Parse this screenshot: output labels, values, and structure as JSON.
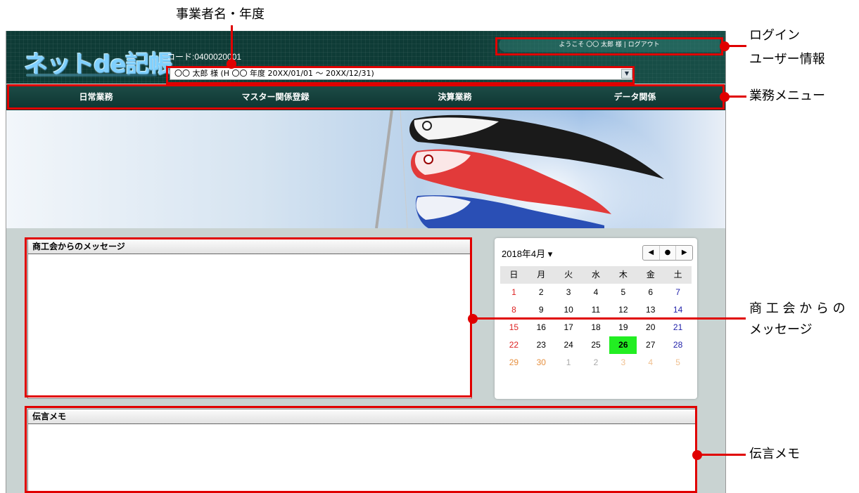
{
  "header": {
    "logo": "ネットde記帳",
    "code_label": "コード:0400020001",
    "year_select_value": "〇〇 太郎 様 (H 〇〇 年度 20XX/01/01 〜 20XX/12/31)",
    "login_info": "ようこそ 〇〇 太郎 様 | ログアウト"
  },
  "menu": {
    "items": [
      "日常業務",
      "マスター関係登録",
      "決算業務",
      "データ関係"
    ]
  },
  "panels": {
    "message_title": "商工会からのメッセージ",
    "memo_title": "伝言メモ"
  },
  "calendar": {
    "title": "2018年4月 ▾",
    "nav": [
      "◀",
      "●",
      "▶"
    ],
    "weekdays": [
      "日",
      "月",
      "火",
      "水",
      "木",
      "金",
      "土"
    ],
    "today": "26",
    "weeks": [
      [
        "1",
        "2",
        "3",
        "4",
        "5",
        "6",
        "7"
      ],
      [
        "8",
        "9",
        "10",
        "11",
        "12",
        "13",
        "14"
      ],
      [
        "15",
        "16",
        "17",
        "18",
        "19",
        "20",
        "21"
      ],
      [
        "22",
        "23",
        "24",
        "25",
        "26",
        "27",
        "28"
      ],
      [
        "29",
        "30",
        "1",
        "2",
        "3",
        "4",
        "5"
      ]
    ]
  },
  "annotations": {
    "business_name_year": "事業者名・年度",
    "login_user_info_line1": "ログイン",
    "login_user_info_line2": "ユーザー情報",
    "business_menu": "業務メニュー",
    "message_line1": "商 工 会 か ら の",
    "message_line2": "メッセージ",
    "memo": "伝言メモ"
  },
  "colors": {
    "annotation_red": "#e00000",
    "header_green": "#0e3b36",
    "today_green": "#22ee22"
  }
}
